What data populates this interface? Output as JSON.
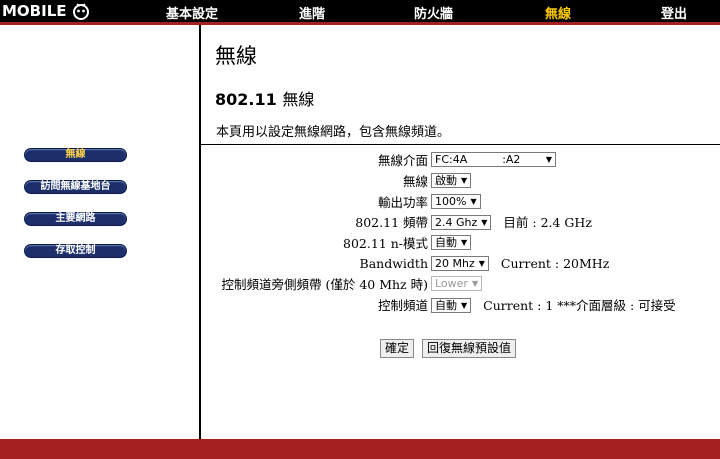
{
  "header": {
    "logo_text": "MOBILE",
    "nav": [
      {
        "label": "基本設定"
      },
      {
        "label": "進階"
      },
      {
        "label": "防火牆"
      },
      {
        "label": "無線"
      },
      {
        "label": "登出"
      }
    ]
  },
  "sidebar": {
    "items": [
      {
        "label": "無線"
      },
      {
        "label": "訪問無線基地台"
      },
      {
        "label": "主要網路"
      },
      {
        "label": "存取控制"
      }
    ]
  },
  "main": {
    "title": "無線",
    "subtitle_prefix": "802.11",
    "subtitle_suffix": "無線",
    "description": "本頁用以設定無線網路，包含無線頻道。",
    "fields": {
      "interface": {
        "label": "無線介面",
        "value": "FC:4A          :A2"
      },
      "wireless": {
        "label": "無線",
        "value": "啟動"
      },
      "power": {
        "label": "輸出功率",
        "value": "100%"
      },
      "band": {
        "label": "802.11 頻帶",
        "value": "2.4 Ghz",
        "current": "目前 : 2.4 GHz"
      },
      "nmode": {
        "label": "802.11 n-模式",
        "value": "自動"
      },
      "bandwidth": {
        "label": "Bandwidth",
        "value": "20 Mhz",
        "current": "Current : 20MHz"
      },
      "sideband": {
        "label": "控制頻道旁側頻帶 (僅於 40 Mhz 時)",
        "value": "Lower"
      },
      "channel": {
        "label": "控制頻道",
        "value": "自動",
        "current": "Current : 1 ***介面層級 : 可接受"
      }
    },
    "buttons": {
      "ok": "確定",
      "reset": "回復無線預設值"
    }
  },
  "colors": {
    "topbar": "#000000",
    "accent_red": "#a52020",
    "active_nav": "#ffcc00",
    "sidebar_button": "#1c2f6b"
  }
}
